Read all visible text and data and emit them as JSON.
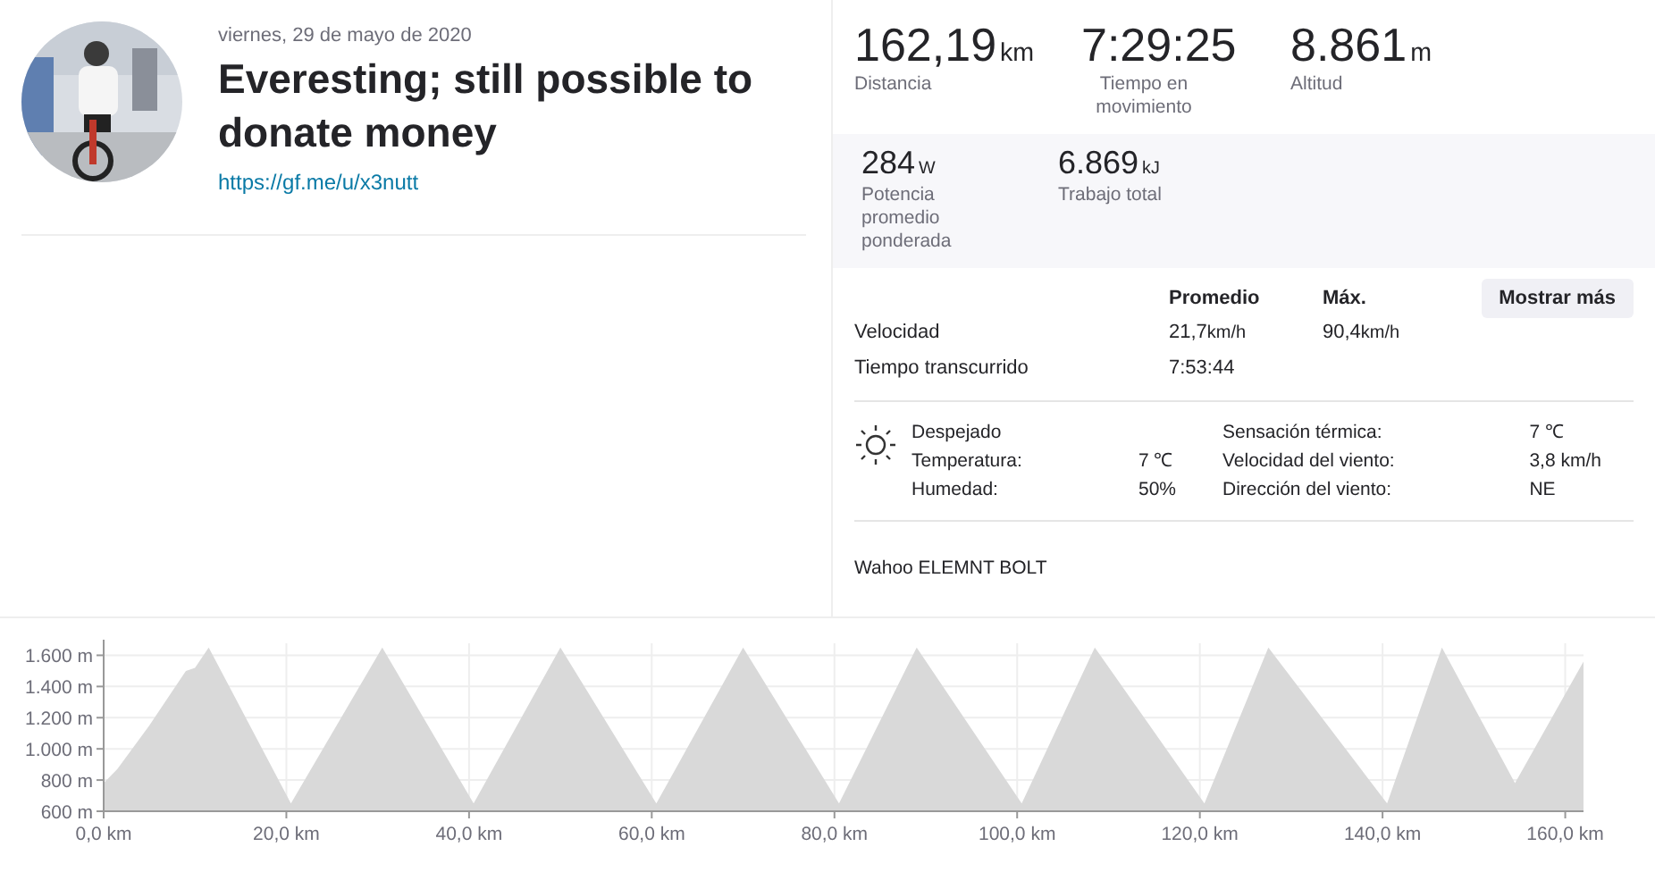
{
  "activity": {
    "date": "viernes, 29 de mayo de 2020",
    "title": "Everesting; still possible to donate money",
    "link": "https://gf.me/u/x3nutt"
  },
  "primary_stats": [
    {
      "value": "162,19",
      "unit": "km",
      "label": "Distancia"
    },
    {
      "value": "7:29:25",
      "label": "Tiempo en movimiento"
    },
    {
      "value": "8.861",
      "unit": "m",
      "label": "Altitud"
    }
  ],
  "secondary_stats": [
    {
      "value": "284",
      "unit": "W",
      "label": "Potencia promedio ponderada"
    },
    {
      "value": "6.869",
      "unit": "kJ",
      "label": "Trabajo total"
    }
  ],
  "more_button": "Mostrar más",
  "table": {
    "columns": [
      "Promedio",
      "Máx."
    ],
    "rows": [
      {
        "label": "Velocidad",
        "cells": [
          {
            "value": "21,7",
            "unit": "km/h"
          },
          {
            "value": "90,4",
            "unit": "km/h"
          }
        ]
      },
      {
        "label": "Tiempo transcurrido",
        "cells": [
          {
            "value": "7:53:44"
          }
        ]
      }
    ]
  },
  "weather": {
    "condition": "Despejado",
    "left": [
      {
        "label": "Temperatura:",
        "value": "7 ℃"
      },
      {
        "label": "Humedad:",
        "value": "50%"
      }
    ],
    "right": [
      {
        "label": "Sensación térmica:",
        "value": "7 ℃"
      },
      {
        "label": "Velocidad del viento:",
        "value": "3,8 km/h"
      },
      {
        "label": "Dirección del viento:",
        "value": "NE"
      }
    ]
  },
  "device": "Wahoo ELEMNT BOLT",
  "elevation": {
    "chart_data": {
      "type": "area",
      "x": [
        0,
        1.5,
        5,
        9,
        10,
        11.5,
        20.5,
        30.5,
        40.5,
        50,
        60.5,
        70,
        80.5,
        89,
        100.5,
        108.5,
        120.5,
        127.5,
        140.5,
        146.5,
        154.5,
        162
      ],
      "grid": true,
      "series": [
        {
          "color": "#d9d9d9",
          "values": [
            780,
            870,
            1150,
            1500,
            1520,
            1650,
            650,
            1650,
            650,
            1650,
            650,
            1650,
            650,
            1650,
            650,
            1650,
            650,
            1650,
            650,
            1650,
            780,
            1560
          ]
        }
      ],
      "xlim": [
        0,
        162
      ],
      "ylim": [
        600,
        1700
      ],
      "xticks": [
        {
          "value": 0,
          "label": "0,0 km"
        },
        {
          "value": 20,
          "label": "20,0 km"
        },
        {
          "value": 40,
          "label": "40,0 km"
        },
        {
          "value": 60,
          "label": "60,0 km"
        },
        {
          "value": 80,
          "label": "80,0 km"
        },
        {
          "value": 100,
          "label": "100,0 km"
        },
        {
          "value": 120,
          "label": "120,0 km"
        },
        {
          "value": 140,
          "label": "140,0 km"
        },
        {
          "value": 160,
          "label": "160,0 km"
        }
      ],
      "yticks": [
        {
          "value": 600,
          "label": "600 m"
        },
        {
          "value": 800,
          "label": "800 m"
        },
        {
          "value": 1000,
          "label": "1.000 m"
        },
        {
          "value": 1200,
          "label": "1.200 m"
        },
        {
          "value": 1400,
          "label": "1.400 m"
        },
        {
          "value": 1600,
          "label": "1.600 m"
        }
      ]
    }
  }
}
